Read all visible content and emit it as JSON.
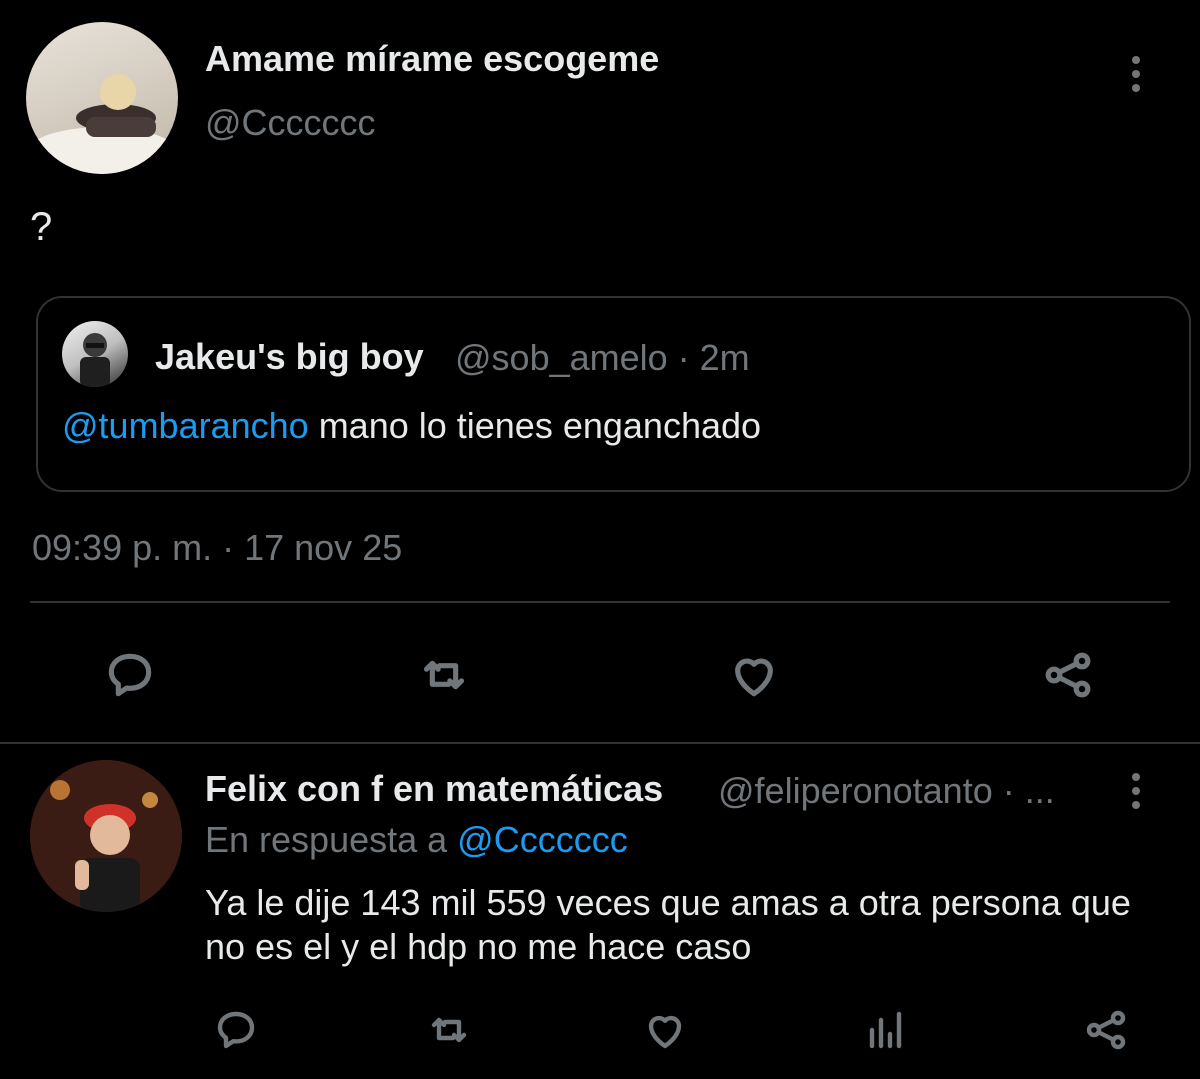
{
  "main_tweet": {
    "display_name": "Amame mírame escogeme",
    "handle": "@Ccccccc",
    "text": "?",
    "timestamp": "09:39 p. m. · 17 nov 25",
    "quoted": {
      "display_name": "Jakeu's big boy",
      "meta": "@sob_amelo · 2m",
      "mention": "@tumbarancho",
      "text": " mano lo tienes enganchado"
    },
    "actions": [
      "reply-icon",
      "retweet-icon",
      "like-icon",
      "share-icon"
    ]
  },
  "reply_tweet": {
    "display_name": "Felix con f en matemáticas",
    "meta": "@feliperonotanto · ...",
    "context_prefix": "En respuesta a ",
    "context_handle": "@Ccccccc",
    "text": "Ya le dije 143 mil 559 veces que amas a otra persona que no es el y el hdp no me hace caso",
    "actions": [
      "reply-icon",
      "retweet-icon",
      "like-icon",
      "views-icon",
      "share-icon"
    ]
  },
  "colors": {
    "background": "#000000",
    "text_primary": "#e7e9ea",
    "text_secondary": "#71767b",
    "accent": "#1d9bf0",
    "border": "#2f3336"
  }
}
